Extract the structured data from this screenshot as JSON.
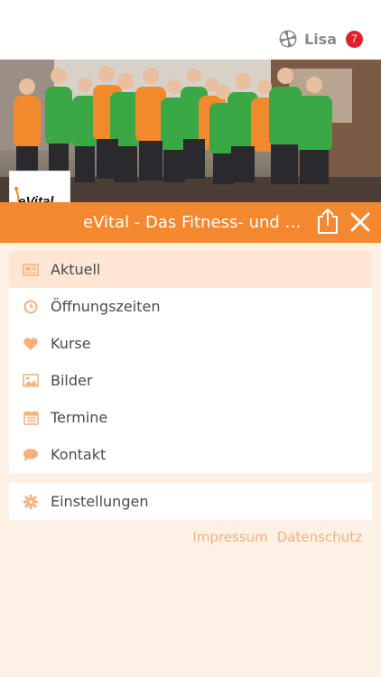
{
  "header": {
    "user_name": "Lisa",
    "notification_count": "7",
    "user_logo_icon": "pinwheel-logo-icon"
  },
  "hero": {
    "image": "team-photo"
  },
  "club": {
    "logo_text": "eVital",
    "title": "eVital - Das Fitness- und Gesundheitszentrum",
    "share_icon": "share-icon",
    "close_icon": "close-icon"
  },
  "menu": {
    "items": [
      {
        "label": "Aktuell",
        "icon": "newspaper-icon",
        "active": true
      },
      {
        "label": "Öffnungszeiten",
        "icon": "clock-icon",
        "active": false
      },
      {
        "label": "Kurse",
        "icon": "heart-icon",
        "active": false
      },
      {
        "label": "Bilder",
        "icon": "image-icon",
        "active": false
      },
      {
        "label": "Termine",
        "icon": "calendar-icon",
        "active": false
      },
      {
        "label": "Kontakt",
        "icon": "chat-bubble-icon",
        "active": false
      }
    ],
    "settings": {
      "label": "Einstellungen",
      "icon": "gear-icon"
    }
  },
  "footer": {
    "impressum": "Impressum",
    "datenschutz": "Datenschutz"
  },
  "colors": {
    "accent": "#f4882f",
    "background": "#fdf1e6",
    "active_item": "#fde6d4",
    "badge": "#e0202a",
    "icon": "#f6b07c"
  }
}
